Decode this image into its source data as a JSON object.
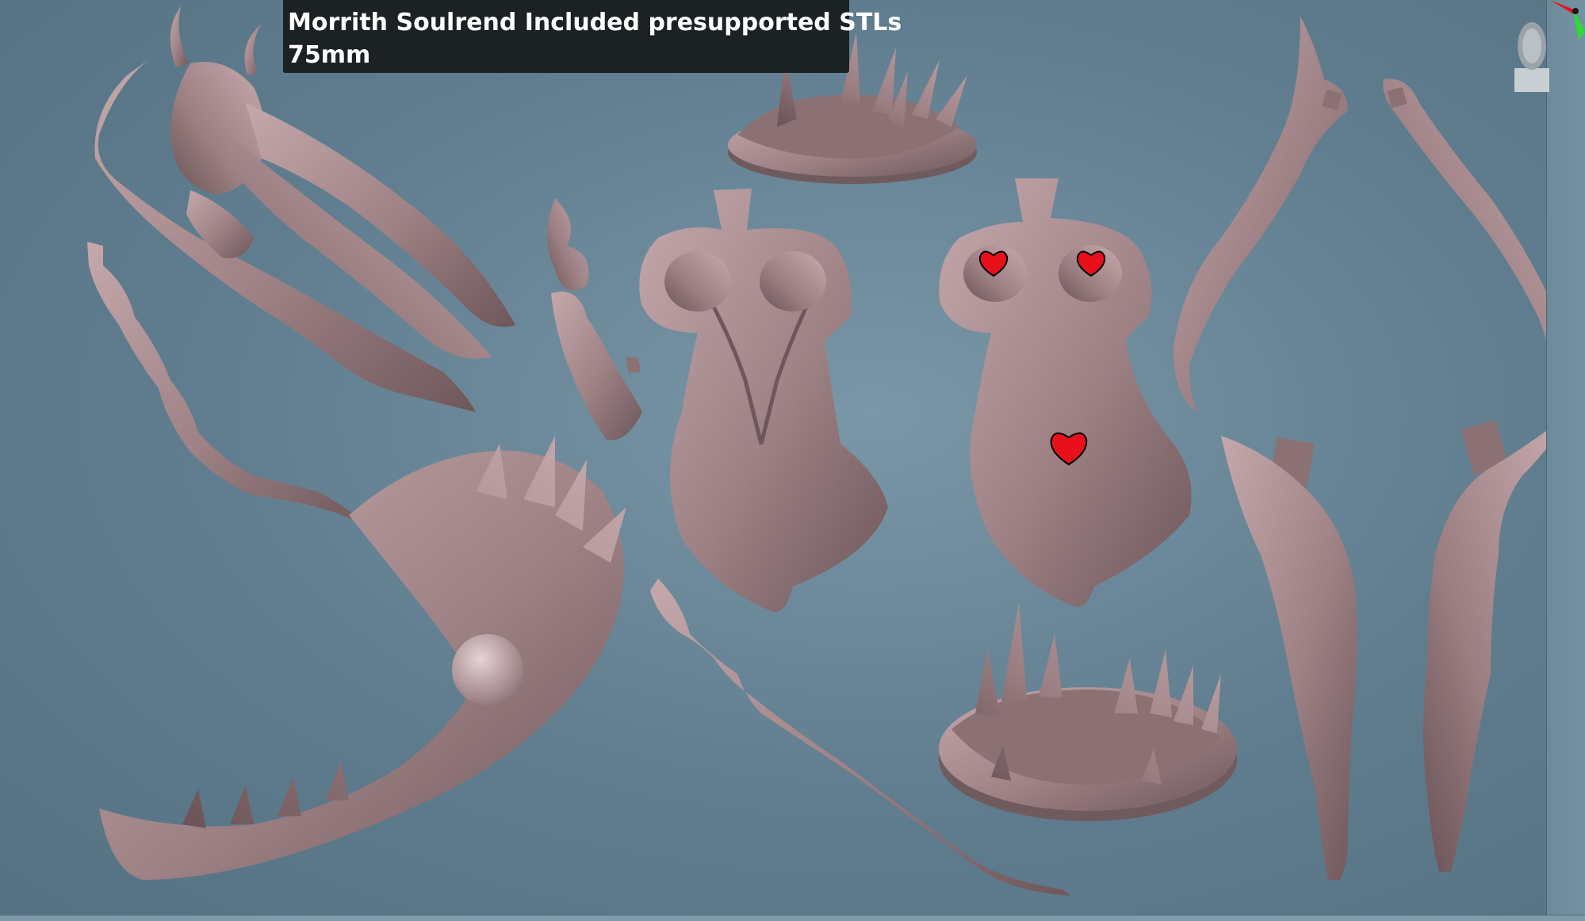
{
  "viewport": {
    "title_line1": "Morrith Soulrend Included presupported STLs",
    "title_line2": "75mm",
    "background_color": "#6a8a9c",
    "model_color": "#9b7f83",
    "censor_color": "#e8101a"
  },
  "gizmos": {
    "axis": "xyz-axis-icon",
    "head": "orientation-head-icon"
  },
  "parts": [
    {
      "name": "head-with-hair",
      "icon": "bust-model"
    },
    {
      "name": "top-base-round",
      "icon": "base-model"
    },
    {
      "name": "flame-hand-arm",
      "icon": "arm-model"
    },
    {
      "name": "torso-front",
      "icon": "torso-model"
    },
    {
      "name": "torso-back",
      "icon": "torso-model"
    },
    {
      "name": "wing-left",
      "icon": "wing-model"
    },
    {
      "name": "wing-right",
      "icon": "wing-model"
    },
    {
      "name": "scythe-weapon",
      "icon": "scythe-model"
    },
    {
      "name": "staff-whip",
      "icon": "staff-model"
    },
    {
      "name": "bottom-base-round",
      "icon": "base-model"
    },
    {
      "name": "leg-left",
      "icon": "leg-model"
    },
    {
      "name": "leg-right",
      "icon": "leg-model"
    }
  ]
}
